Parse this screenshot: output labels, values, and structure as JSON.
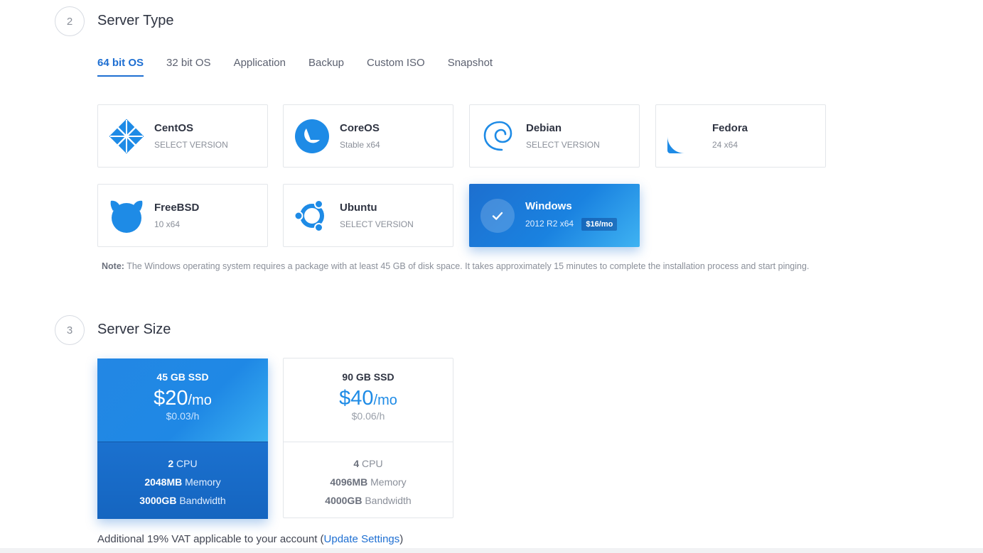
{
  "server_type": {
    "step_number": "2",
    "title": "Server Type",
    "tabs": [
      {
        "label": "64 bit OS",
        "active": true
      },
      {
        "label": "32 bit OS",
        "active": false
      },
      {
        "label": "Application",
        "active": false
      },
      {
        "label": "Backup",
        "active": false
      },
      {
        "label": "Custom ISO",
        "active": false
      },
      {
        "label": "Snapshot",
        "active": false
      }
    ],
    "os_cards": [
      {
        "name": "CentOS",
        "sub": "SELECT VERSION",
        "icon": "centos-icon"
      },
      {
        "name": "CoreOS",
        "sub": "Stable  x64",
        "icon": "coreos-icon"
      },
      {
        "name": "Debian",
        "sub": "SELECT VERSION",
        "icon": "debian-icon"
      },
      {
        "name": "Fedora",
        "sub": "24  x64",
        "icon": "fedora-icon"
      },
      {
        "name": "FreeBSD",
        "sub": "10  x64",
        "icon": "freebsd-icon"
      },
      {
        "name": "Ubuntu",
        "sub": "SELECT VERSION",
        "icon": "ubuntu-icon"
      },
      {
        "name": "Windows",
        "sub": "2012 R2  x64",
        "price": "$16/mo",
        "icon": "check-icon",
        "selected": true
      }
    ],
    "note_label": "Note:",
    "note_text": " The Windows operating system requires a package with at least 45 GB of disk space. It takes approximately 15 minutes to complete the installation process and start pinging."
  },
  "server_size": {
    "step_number": "3",
    "title": "Server Size",
    "plans": [
      {
        "title": "45 GB SSD",
        "price": "$20",
        "per": "/mo",
        "hourly": "$0.03/h",
        "cpu_value": "2",
        "cpu_label": " CPU",
        "memory_value": "2048MB",
        "memory_label": " Memory",
        "bandwidth_value": "3000GB",
        "bandwidth_label": " Bandwidth",
        "selected": true
      },
      {
        "title": "90 GB SSD",
        "price": "$40",
        "per": "/mo",
        "hourly": "$0.06/h",
        "cpu_value": "4",
        "cpu_label": " CPU",
        "memory_value": "4096MB",
        "memory_label": " Memory",
        "bandwidth_value": "4000GB",
        "bandwidth_label": " Bandwidth",
        "selected": false
      }
    ],
    "vat_prefix": "Additional 19% VAT applicable to your account (",
    "vat_link": "Update Settings",
    "vat_suffix": ")"
  },
  "colors": {
    "accent": "#1e6fd2",
    "brand_blue": "#1e8be6",
    "card_border": "#e3e6ea"
  }
}
